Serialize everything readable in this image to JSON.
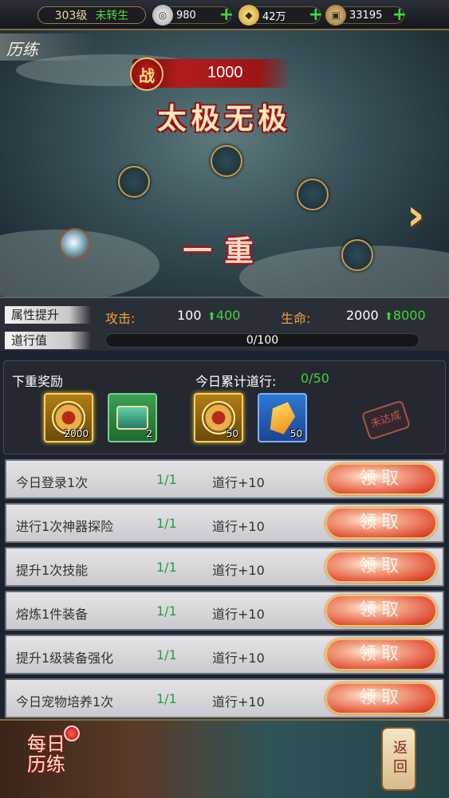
{
  "topbar": {
    "level": "303级",
    "rebirth": "未转生",
    "resources": [
      {
        "icon": "silver-coin-icon",
        "value": "980"
      },
      {
        "icon": "gold-ingot-icon",
        "value": "42万"
      },
      {
        "icon": "copper-coin-icon",
        "value": "33195"
      }
    ],
    "add_symbol": "+"
  },
  "scene": {
    "tab_title": "历练",
    "power_label": "战",
    "power_value": "1000",
    "realm_name": "太极无极",
    "layer_name": "一重"
  },
  "attributes": {
    "tag_attr": "属性提升",
    "tag_dao": "道行值",
    "attack_label": "攻击:",
    "attack_value": "100",
    "attack_increase": "400",
    "hp_label": "生命:",
    "hp_value": "2000",
    "hp_increase": "8000",
    "dao_progress": "0/100"
  },
  "rewards": {
    "next_label": "下重奖励",
    "today_label": "今日累计道行:",
    "today_value": "0/50",
    "next_items": [
      {
        "icon": "medal-icon",
        "count": "2000"
      },
      {
        "icon": "chest-icon",
        "count": "2"
      }
    ],
    "today_items": [
      {
        "icon": "medal-icon",
        "count": "50"
      },
      {
        "icon": "gem-icon",
        "count": "50"
      }
    ],
    "stamp": "未达成"
  },
  "tasks": [
    {
      "name": "今日登录1次",
      "progress": "1/1",
      "reward": "道行+10",
      "button": "领取"
    },
    {
      "name": "进行1次神器探险",
      "progress": "1/1",
      "reward": "道行+10",
      "button": "领取"
    },
    {
      "name": "提升1次技能",
      "progress": "1/1",
      "reward": "道行+10",
      "button": "领取"
    },
    {
      "name": "熔炼1件装备",
      "progress": "1/1",
      "reward": "道行+10",
      "button": "领取"
    },
    {
      "name": "提升1级装备强化",
      "progress": "1/1",
      "reward": "道行+10",
      "button": "领取"
    },
    {
      "name": "今日宠物培养1次",
      "progress": "1/1",
      "reward": "道行+10",
      "button": "领取"
    }
  ],
  "bottom": {
    "daily_label_1": "每日",
    "daily_label_2": "历练",
    "back_label": "返回"
  },
  "colors": {
    "accent_green": "#44d23c",
    "accent_orange": "#f0a23a",
    "power_red": "#b11c1c"
  }
}
